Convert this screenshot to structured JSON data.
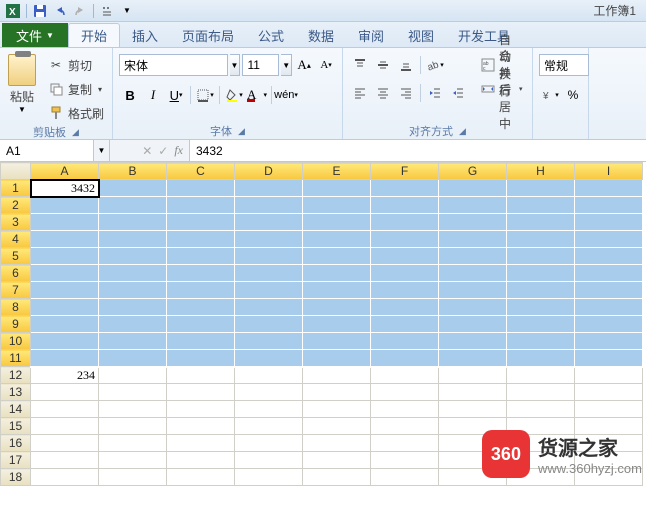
{
  "qat": {
    "workbook_title": "工作簿1"
  },
  "tabs": {
    "file": "文件",
    "items": [
      "开始",
      "插入",
      "页面布局",
      "公式",
      "数据",
      "审阅",
      "视图",
      "开发工具"
    ],
    "active": 0
  },
  "ribbon": {
    "clipboard": {
      "paste": "粘贴",
      "cut": "剪切",
      "copy": "复制",
      "format_painter": "格式刷",
      "label": "剪贴板"
    },
    "font": {
      "name": "宋体",
      "size": "11",
      "label": "字体"
    },
    "align": {
      "wrap": "自动换行",
      "merge": "合并后居中",
      "label": "对齐方式"
    },
    "number": {
      "format": "常规",
      "percent": "%"
    }
  },
  "fbar": {
    "name": "A1",
    "fx": "fx",
    "value": "3432"
  },
  "grid": {
    "cols": [
      "A",
      "B",
      "C",
      "D",
      "E",
      "F",
      "G",
      "H",
      "I"
    ],
    "rows": 18,
    "sel_rows": 11,
    "cells": {
      "A1": "3432",
      "A12": "234"
    }
  },
  "watermark": {
    "badge": "360",
    "title": "货源之家",
    "url": "www.360hyzj.com"
  }
}
